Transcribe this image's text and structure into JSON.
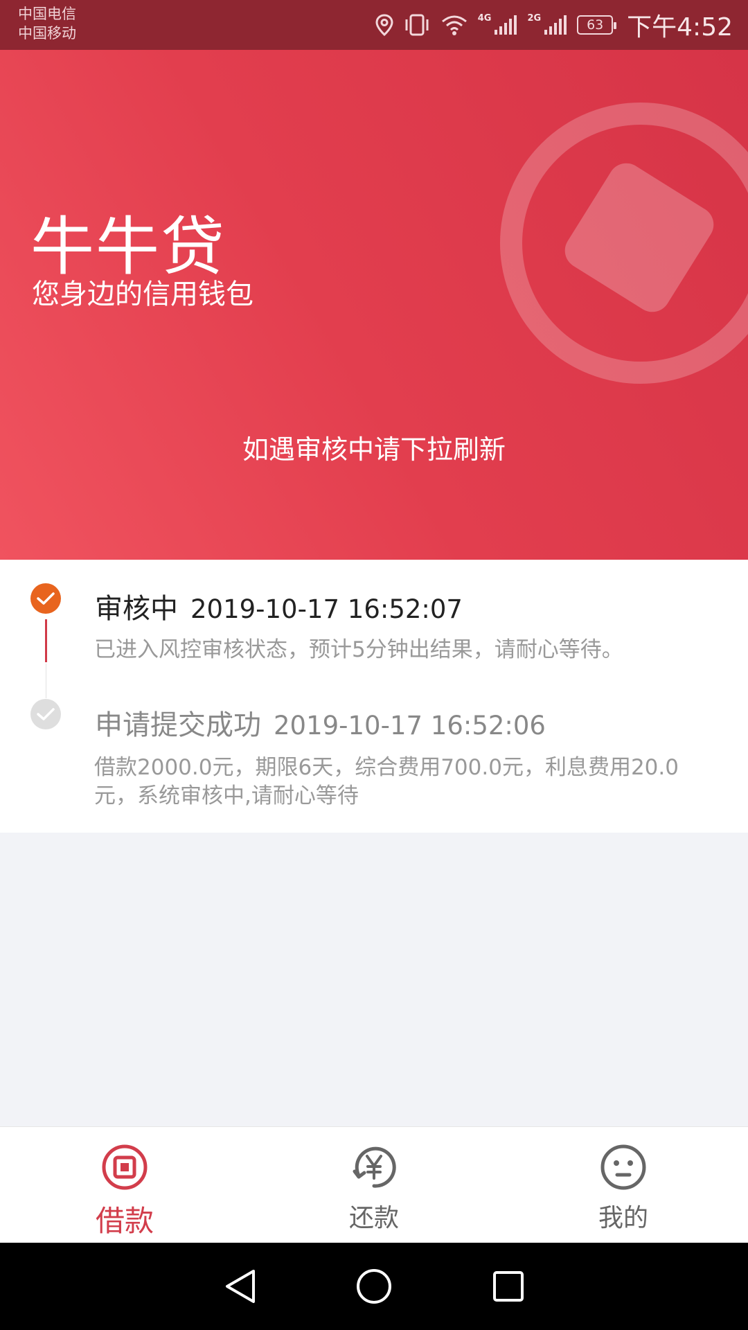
{
  "status_bar": {
    "carrier_1": "中国电信",
    "carrier_2": "中国移动",
    "network_1": "4G",
    "network_2": "2G",
    "battery": "63",
    "time": "下午4:52"
  },
  "hero": {
    "title": "牛牛贷",
    "slogan": "您身边的信用钱包",
    "hint": "如遇审核中请下拉刷新"
  },
  "timeline": [
    {
      "status": "审核中",
      "time": "2019-10-17 16:52:07",
      "description": "已进入风控审核状态，预计5分钟出结果，请耐心等待。",
      "state": "active"
    },
    {
      "status": "申请提交成功",
      "time": "2019-10-17 16:52:06",
      "description": "借款2000.0元，期限6天，综合费用700.0元，利息费用20.0元，系统审核中,请耐心等待",
      "state": "done"
    }
  ],
  "bottom_nav": [
    {
      "label": "借款",
      "icon": "loan-icon",
      "active": true
    },
    {
      "label": "还款",
      "icon": "repay-icon",
      "active": false
    },
    {
      "label": "我的",
      "icon": "profile-icon",
      "active": false
    }
  ],
  "colors": {
    "brand_red": "#d23d4b",
    "status_bar": "#8e2631",
    "active_step": "#e8641e"
  }
}
